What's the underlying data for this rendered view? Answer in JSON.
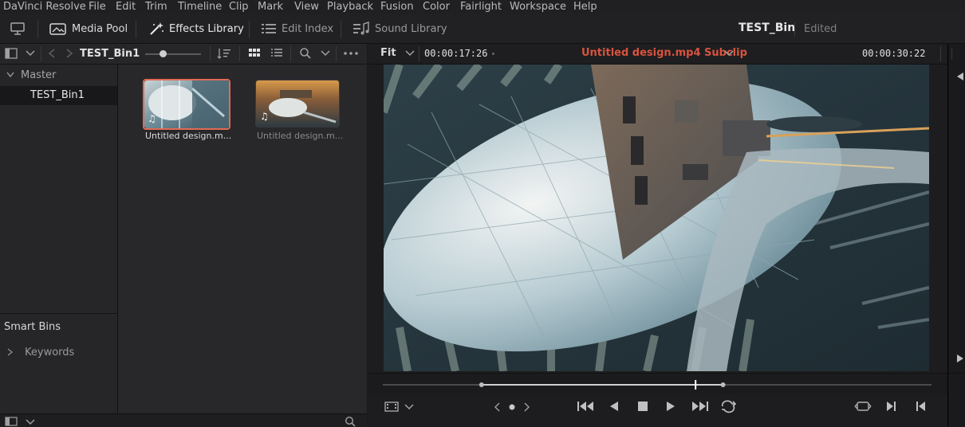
{
  "menu": {
    "items": [
      "DaVinci Resolve",
      "File",
      "Edit",
      "Trim",
      "Timeline",
      "Clip",
      "Mark",
      "View",
      "Playback",
      "Fusion",
      "Color",
      "Fairlight",
      "Workspace",
      "Help"
    ]
  },
  "toolbar": {
    "media_pool": "Media Pool",
    "effects_library": "Effects Library",
    "edit_index": "Edit Index",
    "sound_library": "Sound Library",
    "project_title": "TEST_Bin",
    "project_status": "Edited"
  },
  "bin_header": {
    "bin_name": "TEST_Bin1"
  },
  "tree": {
    "master": "Master",
    "bins": [
      "TEST_Bin1"
    ],
    "smart_bins": "Smart Bins",
    "keywords": "Keywords"
  },
  "clips": [
    {
      "name": "Untitled design.m...",
      "selected": true
    },
    {
      "name": "Untitled design.m...",
      "selected": false
    }
  ],
  "viewer": {
    "zoom": "Fit",
    "timecode_left": "00:00:17:26",
    "clip_title": "Untitled design.mp4 Subclip",
    "timecode_right": "00:00:30:22"
  },
  "colors": {
    "accent": "#e8604c",
    "selection": "#e06a55",
    "clip_title": "#d9533e"
  },
  "scrubber": {
    "in_fraction": 0.18,
    "playhead_fraction": 0.57,
    "out_fraction": 0.62
  }
}
